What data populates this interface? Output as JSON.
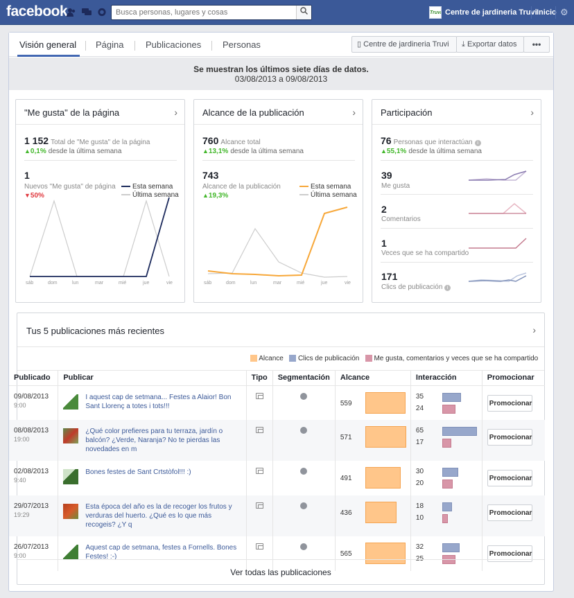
{
  "topbar": {
    "logo": "facebook",
    "search_placeholder": "Busca personas, lugares y cosas",
    "profile_badge": "Truvi",
    "profile_name": "Centre de jardineria Truvi",
    "home": "Inicio",
    "colors": {
      "bar": "#3b5998"
    }
  },
  "tabs": [
    "Visión general",
    "Página",
    "Publicaciones",
    "Personas"
  ],
  "toolbar": {
    "page_button": "Centre de jardineria Truvi",
    "export_button": "Exportar datos",
    "more_button": "•••"
  },
  "banner": {
    "title": "Se muestran los últimos siete días de datos.",
    "range": "03/08/2013 a 09/08/2013"
  },
  "likes_card": {
    "title": "\"Me gusta\" de la página",
    "total_value": "1 152",
    "total_label": "Total de \"Me gusta\" de la página",
    "total_change": "0,1%",
    "since": "desde la última semana",
    "new_value": "1",
    "new_label": "Nuevos \"Me gusta\" de página",
    "new_change": "50%",
    "legend_this": "Esta semana",
    "legend_last": "Última semana",
    "days": [
      "sáb",
      "dom",
      "lun",
      "mar",
      "mié",
      "jue",
      "vie"
    ]
  },
  "reach_card": {
    "title": "Alcance de la publicación",
    "total_value": "760",
    "total_label": "Alcance total",
    "total_change": "13,1%",
    "since": "desde la última semana",
    "post_value": "743",
    "post_label": "Alcance de la publicación",
    "post_change": "19,3%",
    "legend_this": "Esta semana",
    "legend_last": "Última semana",
    "days": [
      "sáb",
      "dom",
      "lun",
      "mar",
      "mié",
      "jue",
      "vie"
    ]
  },
  "engagement_card": {
    "title": "Participación",
    "total_value": "76",
    "total_label": "Personas que interactúan",
    "total_change": "55,1%",
    "since": "desde la última semana",
    "rows": [
      {
        "value": "39",
        "label": "Me gusta"
      },
      {
        "value": "2",
        "label": "Comentarios"
      },
      {
        "value": "1",
        "label": "Veces que se ha compartido"
      },
      {
        "value": "171",
        "label": "Clics de publicación"
      }
    ]
  },
  "posts": {
    "title": "Tus 5 publicaciones más recientes",
    "legend": [
      "Alcance",
      "Clics de publicación",
      "Me gusta, comentarios y veces que se ha compartido"
    ],
    "columns": [
      "Publicado",
      "Publicar",
      "Tipo",
      "Segmentación",
      "Alcance",
      "Interacción",
      "Promocionar"
    ],
    "promote_label": "Promocionar",
    "view_all": "Ver todas las publicaciones",
    "rows": [
      {
        "date": "09/08/2013",
        "time": "9:00",
        "text": "I aquest cap de setmana... Festes a Alaior! Bon Sant Llorenç a totes i tots!!!",
        "reach": "559",
        "clicks": "35",
        "likes": "24"
      },
      {
        "date": "08/08/2013",
        "time": "19:00",
        "text": "¿Qué color prefieres para tu terraza, jardín o balcón? ¿Verde, Naranja? No te pierdas las novedades en m",
        "reach": "571",
        "clicks": "65",
        "likes": "17"
      },
      {
        "date": "02/08/2013",
        "time": "9:40",
        "text": "Bones festes de Sant Crtstòfol!!! :)",
        "reach": "491",
        "clicks": "30",
        "likes": "20"
      },
      {
        "date": "29/07/2013",
        "time": "19:29",
        "text": "Esta época del año es la de recoger los frutos y verduras del huerto. ¿Qué es lo que más recogeis? ¿Y q",
        "reach": "436",
        "clicks": "18",
        "likes": "10"
      },
      {
        "date": "26/07/2013",
        "time": "9:00",
        "text": "Aquest cap de setmana, festes a Fornells. Bones Festes! :-)",
        "reach": "565",
        "clicks": "32",
        "likes": "25"
      }
    ]
  }
}
